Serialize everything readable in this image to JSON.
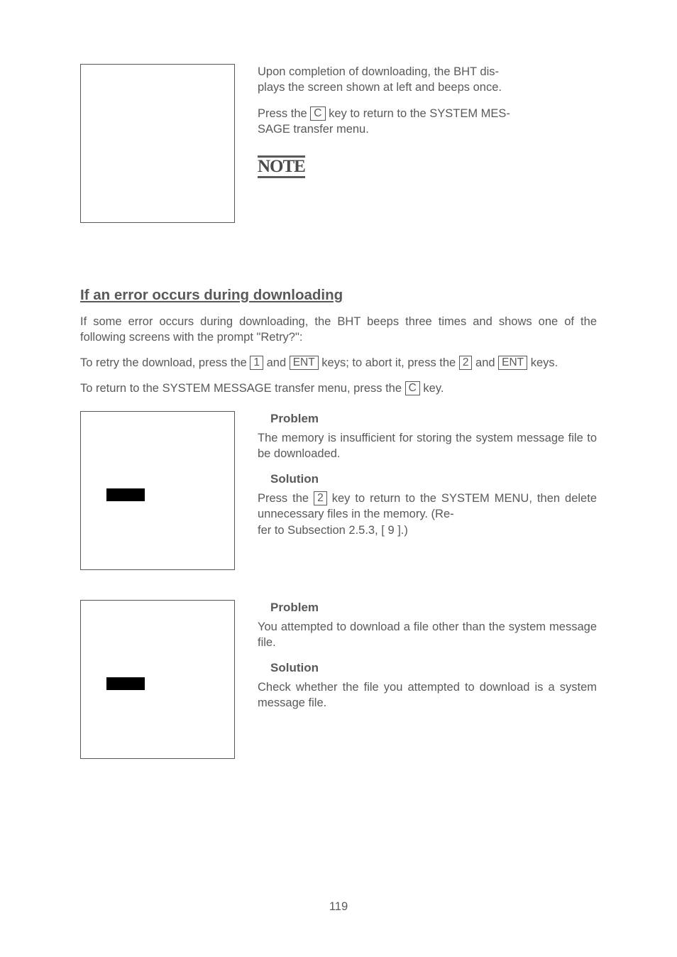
{
  "top": {
    "p1a": "Upon completion of downloading, the BHT dis-",
    "p1b": "plays the screen shown at left and beeps once.",
    "p2a": "Press the ",
    "p2_key": "C",
    "p2b": " key to return to the SYSTEM MES-",
    "p2c": "SAGE transfer menu.",
    "note": "NOTE"
  },
  "sec": {
    "heading": "If an error occurs during downloading",
    "p1": "If some error occurs during downloading, the BHT beeps three times and shows one of the following screens with the prompt \"Retry?\":",
    "p2a": "To retry the download, press the ",
    "k1": "1",
    "p2b": " and ",
    "kent": "ENT",
    "p2c": " keys; to abort it, press the ",
    "k2": "2",
    "p2d": " and ",
    "p2e": " keys.",
    "p3a": "To return to the SYSTEM MESSAGE transfer menu, press the ",
    "kc": "C",
    "p3b": " key."
  },
  "err1": {
    "problem_h": "Problem",
    "problem_t": "The memory is insufficient for storing the system message file to be downloaded.",
    "solution_h": "Solution",
    "sol_a": "Press the ",
    "sol_key": "2",
    "sol_b": " key to return to the SYSTEM MENU, then delete unnecessary files in the memory.  (Re-",
    "sol_c": "fer to Subsection 2.5.3, [ 9 ].)"
  },
  "err2": {
    "problem_h": "Problem",
    "problem_t": "You attempted to download a file other than the system message file.",
    "solution_h": "Solution",
    "solution_t": "Check whether the file you attempted to download is a system message file."
  },
  "pagenum": "119"
}
